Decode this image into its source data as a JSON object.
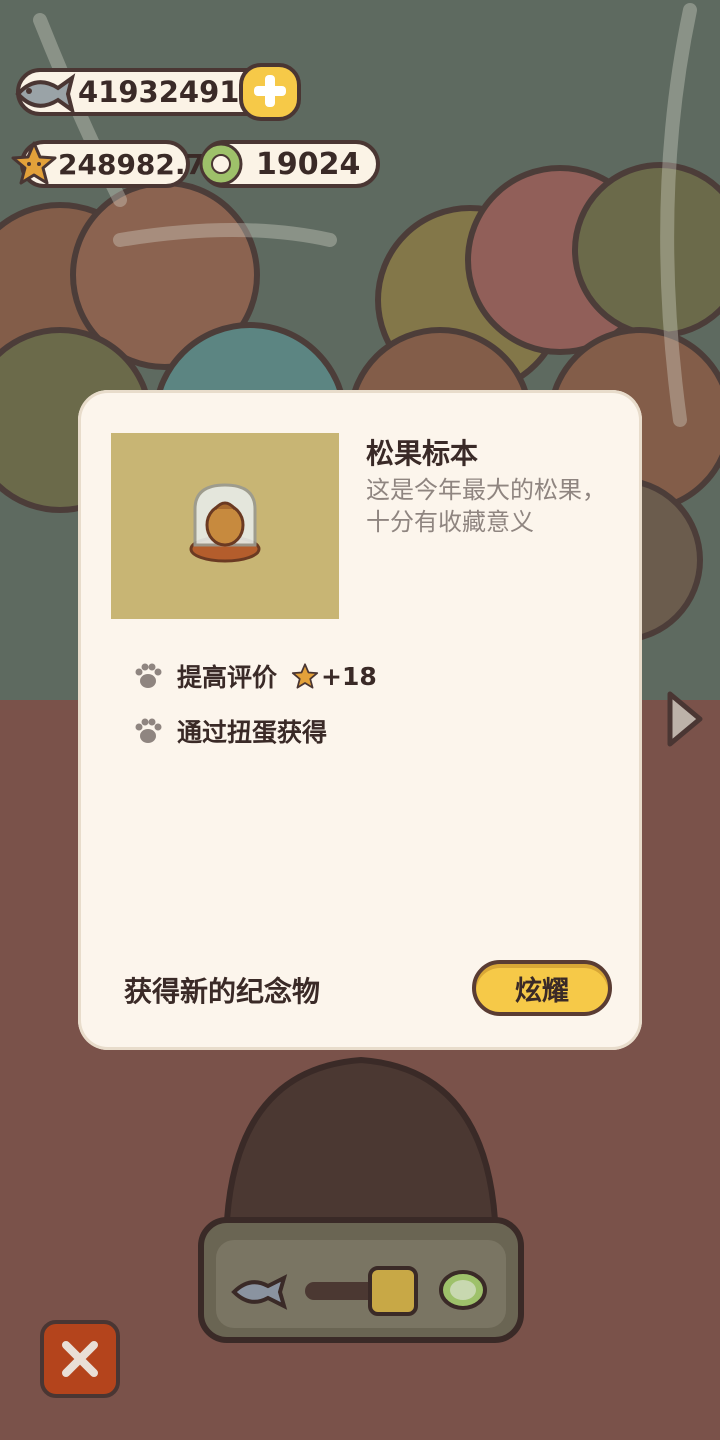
{
  "currency": {
    "fish_count": "419324919",
    "star_count": "248982.7",
    "ring_count": "19024",
    "add_label": "+"
  },
  "modal": {
    "item_name": "松果标本",
    "item_description": "这是今年最大的松果，十分有收藏意义",
    "rows": [
      {
        "label": "提高评价",
        "value": "+18"
      },
      {
        "label": "通过扭蛋获得"
      }
    ],
    "footer_text": "获得新的纪念物",
    "show_button": "炫耀"
  },
  "colors": {
    "accent": "#f6c948",
    "modal_bg": "#fcf5ec",
    "close": "#b4441c",
    "outline": "#4a3633"
  }
}
